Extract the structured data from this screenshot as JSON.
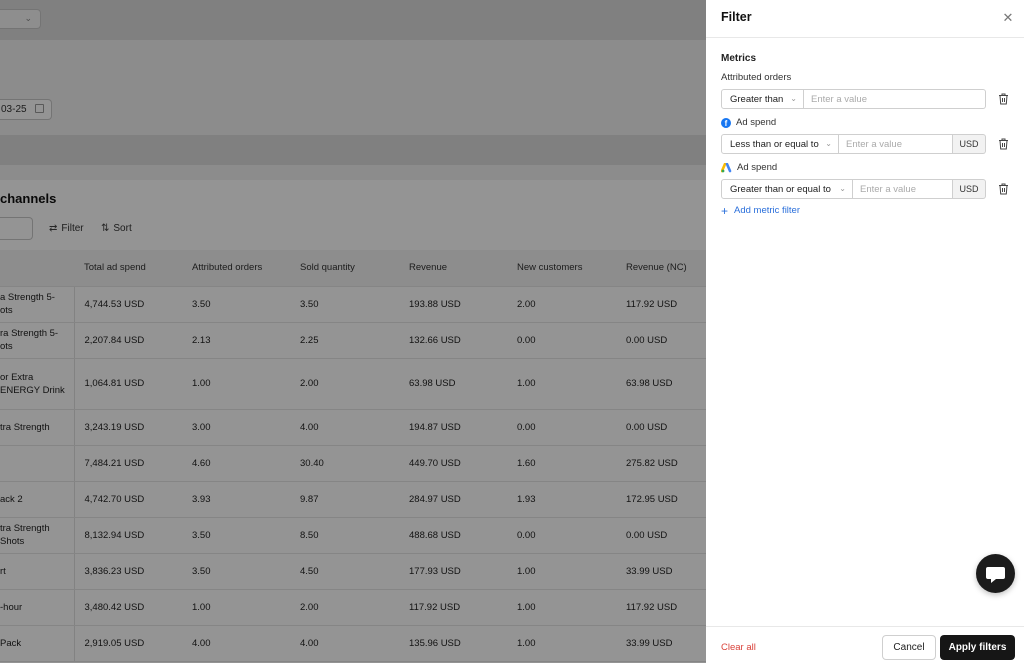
{
  "background": {
    "date_value": "03-25",
    "section_title": "channels",
    "toolbar": {
      "filter_label": "Filter",
      "sort_label": "Sort"
    },
    "table": {
      "headers": [
        "",
        "Total ad spend",
        "Attributed orders",
        "Sold quantity",
        "Revenue",
        "New customers",
        "Revenue (NC)"
      ],
      "rows": [
        {
          "name": [
            "a Strength 5-",
            "ots"
          ],
          "cells": [
            "4,744.53 USD",
            "3.50",
            "3.50",
            "193.88 USD",
            "2.00",
            "117.92 USD"
          ]
        },
        {
          "name": [
            "ra Strength 5-",
            "ots"
          ],
          "cells": [
            "2,207.84 USD",
            "2.13",
            "2.25",
            "132.66 USD",
            "0.00",
            "0.00 USD"
          ]
        },
        {
          "name": [
            "or Extra",
            "ENERGY Drink"
          ],
          "cells": [
            "1,064.81 USD",
            "1.00",
            "2.00",
            "63.98 USD",
            "1.00",
            "63.98 USD"
          ]
        },
        {
          "name": [
            "tra Strength",
            ""
          ],
          "cells": [
            "3,243.19 USD",
            "3.00",
            "4.00",
            "194.87 USD",
            "0.00",
            "0.00 USD"
          ]
        },
        {
          "name": [
            "",
            ""
          ],
          "cells": [
            "7,484.21 USD",
            "4.60",
            "30.40",
            "449.70 USD",
            "1.60",
            "275.82 USD"
          ]
        },
        {
          "name": [
            "ack 2",
            ""
          ],
          "cells": [
            "4,742.70 USD",
            "3.93",
            "9.87",
            "284.97 USD",
            "1.93",
            "172.95 USD"
          ]
        },
        {
          "name": [
            "tra Strength",
            "Shots"
          ],
          "cells": [
            "8,132.94 USD",
            "3.50",
            "8.50",
            "488.68 USD",
            "0.00",
            "0.00 USD"
          ]
        },
        {
          "name": [
            "rt",
            ""
          ],
          "cells": [
            "3,836.23 USD",
            "3.50",
            "4.50",
            "177.93 USD",
            "1.00",
            "33.99 USD"
          ]
        },
        {
          "name": [
            "-hour",
            ""
          ],
          "cells": [
            "3,480.42 USD",
            "1.00",
            "2.00",
            "117.92 USD",
            "1.00",
            "117.92 USD"
          ]
        },
        {
          "name": [
            "Pack",
            ""
          ],
          "cells": [
            "2,919.05 USD",
            "4.00",
            "4.00",
            "135.96 USD",
            "1.00",
            "33.99 USD"
          ]
        }
      ]
    }
  },
  "drawer": {
    "title": "Filter",
    "section_label": "Metrics",
    "filters": [
      {
        "label": "Attributed orders",
        "icon": "none",
        "operator": "Greater than",
        "placeholder": "Enter a value",
        "unit": ""
      },
      {
        "label": "Ad spend",
        "icon": "facebook-icon",
        "operator": "Less than or equal to",
        "placeholder": "Enter a value",
        "unit": "USD"
      },
      {
        "label": "Ad spend",
        "icon": "google-ads-icon",
        "operator": "Greater than or equal to",
        "placeholder": "Enter a value",
        "unit": "USD"
      }
    ],
    "add_metric_label": "Add metric filter",
    "clear_all_label": "Clear all",
    "cancel_label": "Cancel",
    "apply_label": "Apply filters"
  },
  "colors": {
    "accent_link": "#2a6fdb",
    "danger": "#d9423a",
    "primary_button": "#161616",
    "facebook": "#1877f2"
  }
}
